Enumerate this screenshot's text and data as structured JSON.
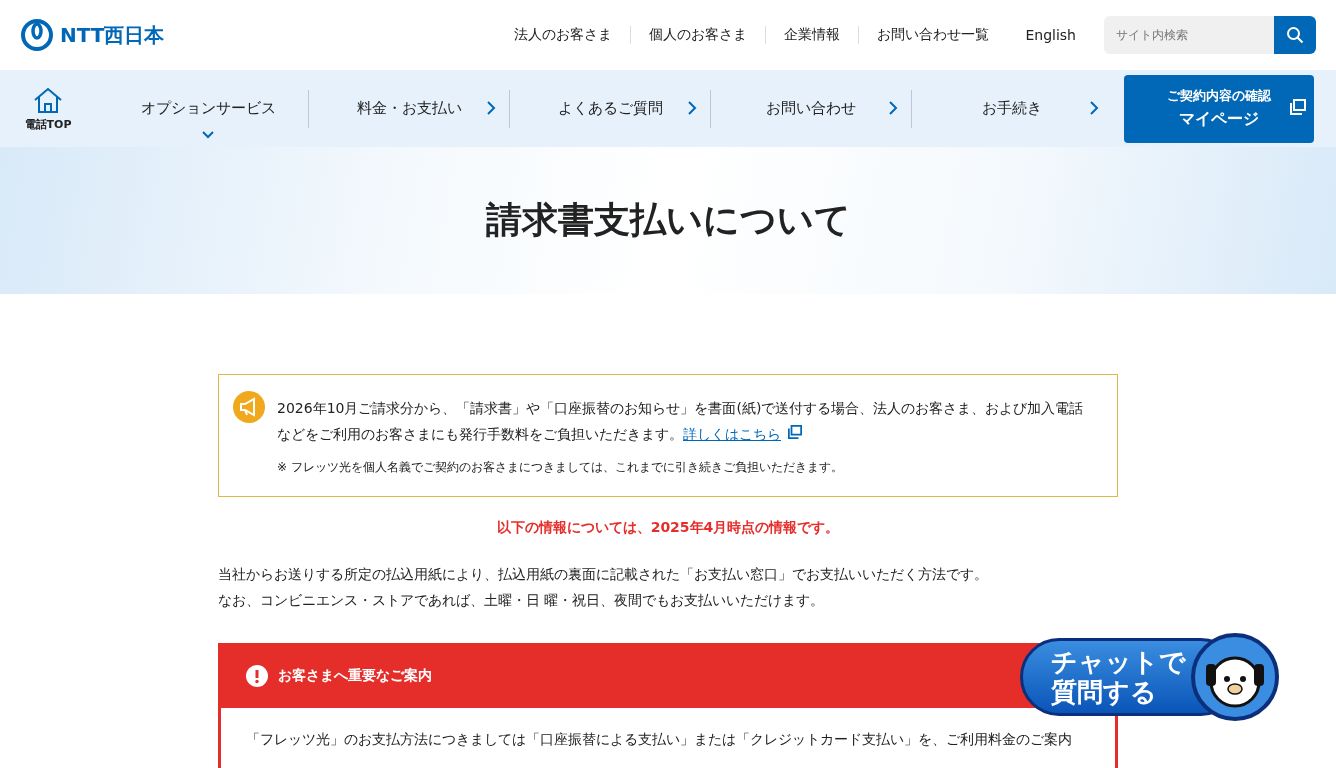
{
  "header": {
    "logo": "NTT西日本",
    "links": [
      "法人のお客さま",
      "個人のお客さま",
      "企業情報",
      "お問い合わせ一覧"
    ],
    "language": "English",
    "search": {
      "placeholder": "サイト内検索"
    }
  },
  "nav": {
    "home": "電話TOP",
    "items": [
      {
        "label": "オプションサービス",
        "kind": "dropdown"
      },
      {
        "label": "料金・お支払い",
        "kind": "link"
      },
      {
        "label": "よくあるご質問",
        "kind": "link"
      },
      {
        "label": "お問い合わせ",
        "kind": "link"
      },
      {
        "label": "お手続き",
        "kind": "link"
      }
    ],
    "mypage": {
      "line1": "ご契約内容の確認",
      "line2": "マイページ"
    }
  },
  "page_title": "請求書支払いについて",
  "notice": {
    "text": "2026年10月ご請求分から、「請求書」や「口座振替のお知らせ」を書面(紙)で送付する場合、法人のお客さま、および加入電話などをご利用のお客さまにも発行手数料をご負担いただきます。",
    "link": "詳しくはこちら",
    "note": "※ フレッツ光を個人名義でご契約のお客さまにつきましては、これまでに引き続きご負担いただきます。"
  },
  "info_date": "以下の情報については、2025年4月時点の情報です。",
  "intro": [
    "当社からお送りする所定の払込用紙により、払込用紙の裏面に記載された「お支払い窓口」でお支払いいただく方法です。",
    "なお、コンビニエンス・ストアであれば、土曜・日 曜・祝日、夜間でもお支払いいただけます。"
  ],
  "important": {
    "title": "お客さまへ重要なご案内",
    "body": "「フレッツ光」のお支払方法につきましては「口座振替による支払い」または「クレジットカード支払い」を、ご利用料金のご案内"
  },
  "chat": {
    "line1": "チャットで",
    "line2": "質問する"
  }
}
